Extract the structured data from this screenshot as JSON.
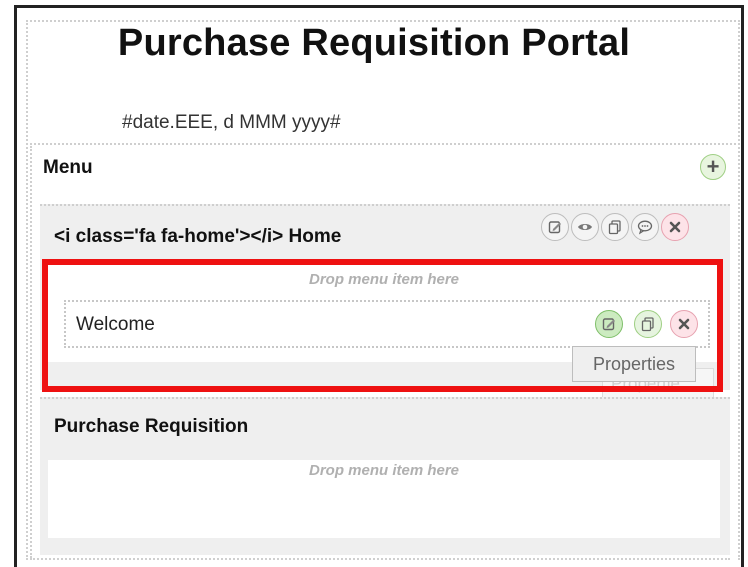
{
  "header": {
    "title": "Purchase Requisition Portal",
    "date_placeholder": "#date.EEE, d MMM yyyy#"
  },
  "menu": {
    "title": "Menu",
    "add_icon": "plus-icon",
    "groups": [
      {
        "label": "<i class='fa fa-home'></i> Home",
        "actions": [
          "edit-icon",
          "eye-icon",
          "copy-icon",
          "comment-icon",
          "delete-icon"
        ],
        "drop_text": "Drop menu item here",
        "items": [
          {
            "label": "Welcome",
            "actions": [
              "edit-icon",
              "copy-icon",
              "delete-icon"
            ],
            "tooltip": "Properties",
            "tooltip_ghost": "Propertie"
          }
        ]
      },
      {
        "label": "Purchase Requisition",
        "drop_text": "Drop menu item here"
      }
    ]
  },
  "colors": {
    "highlight": "#ee1111",
    "add_green": "#e8f5df",
    "delete_pink": "#fde3e8"
  }
}
